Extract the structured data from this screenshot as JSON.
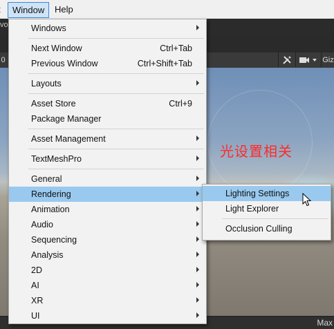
{
  "menubar": {
    "file_fragment": "t",
    "window": "Window",
    "help": "Help"
  },
  "editor": {
    "tab_fragment": "vo",
    "toolbar_left_fragment": "0",
    "toolbar_right_fragment": "Giz",
    "bottom_right_fragment": "Max"
  },
  "annotation": "光设置相关",
  "window_menu": {
    "groups": [
      [
        {
          "label": "Windows",
          "submenu": true
        }
      ],
      [
        {
          "label": "Next Window",
          "shortcut": "Ctrl+Tab"
        },
        {
          "label": "Previous Window",
          "shortcut": "Ctrl+Shift+Tab"
        }
      ],
      [
        {
          "label": "Layouts",
          "submenu": true
        }
      ],
      [
        {
          "label": "Asset Store",
          "shortcut": "Ctrl+9"
        },
        {
          "label": "Package Manager"
        }
      ],
      [
        {
          "label": "Asset Management",
          "submenu": true
        }
      ],
      [
        {
          "label": "TextMeshPro",
          "submenu": true
        }
      ],
      [
        {
          "label": "General",
          "submenu": true
        },
        {
          "label": "Rendering",
          "submenu": true,
          "highlighted": true
        },
        {
          "label": "Animation",
          "submenu": true
        },
        {
          "label": "Audio",
          "submenu": true
        },
        {
          "label": "Sequencing",
          "submenu": true
        },
        {
          "label": "Analysis",
          "submenu": true
        },
        {
          "label": "2D",
          "submenu": true
        },
        {
          "label": "AI",
          "submenu": true
        },
        {
          "label": "XR",
          "submenu": true
        },
        {
          "label": "UI",
          "submenu": true
        }
      ]
    ]
  },
  "rendering_submenu": {
    "groups": [
      [
        {
          "label": "Lighting Settings",
          "highlighted": true
        },
        {
          "label": "Light Explorer"
        }
      ],
      [
        {
          "label": "Occlusion Culling"
        }
      ]
    ]
  },
  "colors": {
    "menu_bg": "#f2f2f2",
    "highlight": "#99c9ef",
    "annotation": "#ff2a2a"
  }
}
